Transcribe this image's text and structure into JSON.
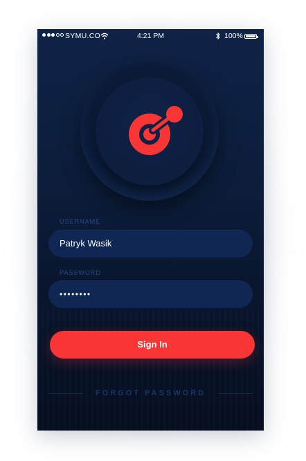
{
  "status_bar": {
    "carrier": "SYMU.CO",
    "time": "4:21 PM",
    "battery": "100%"
  },
  "logo": {
    "icon": "app-logo-icon",
    "color": "#f93535"
  },
  "form": {
    "username_label": "USERNAME",
    "username_value": "Patryk Wasik",
    "password_label": "PASSWORD",
    "password_value": "••••••••"
  },
  "actions": {
    "sign_in": "Sign In",
    "forgot_password": "FORGOT PASSWORD"
  },
  "colors": {
    "accent": "#f93535",
    "background": "#0c1d3b",
    "field": "#0f2752",
    "label": "#2b4a86"
  }
}
